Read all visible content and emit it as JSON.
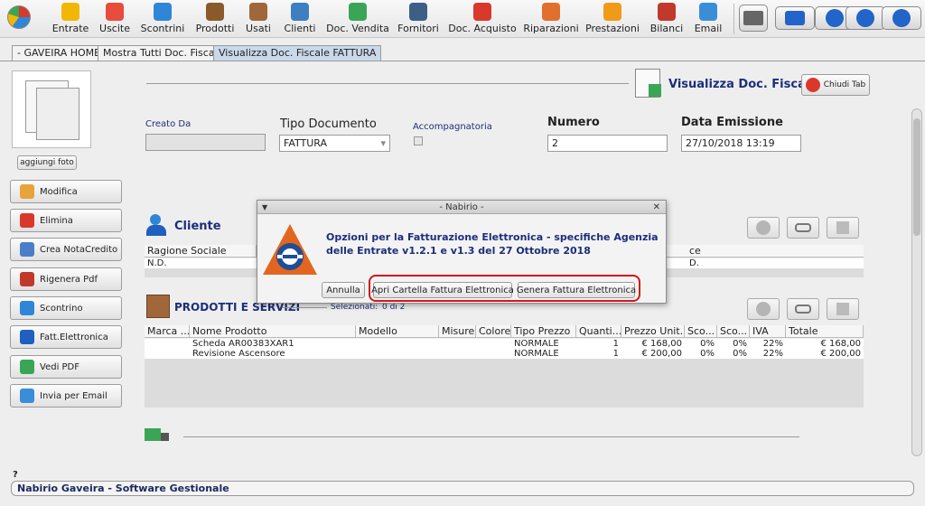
{
  "toolbar": {
    "items": [
      {
        "label": "Entrate",
        "color": "#f2b705"
      },
      {
        "label": "Uscite",
        "color": "#e74c3c"
      },
      {
        "label": "Scontrini",
        "color": "#2f86d6"
      },
      {
        "label": "Prodotti",
        "color": "#8b5a2b"
      },
      {
        "label": "Usati",
        "color": "#a0673a"
      },
      {
        "label": "Clienti",
        "color": "#3e7fc1"
      },
      {
        "label": "Doc. Vendita",
        "color": "#3aa655"
      },
      {
        "label": "Fornitori",
        "color": "#3c5f85"
      },
      {
        "label": "Doc. Acquisto",
        "color": "#d9392b"
      },
      {
        "label": "Riparazioni",
        "color": "#e0702c"
      },
      {
        "label": "Prestazioni",
        "color": "#f09a1a"
      },
      {
        "label": "Bilanci",
        "color": "#c0392b"
      },
      {
        "label": "Email",
        "color": "#3a8ed8"
      }
    ]
  },
  "tabs": [
    "- GAVEIRA HOME -",
    "Mostra Tutti Doc. Fiscale",
    "Visualizza Doc. Fiscale FATTURA"
  ],
  "left": {
    "add_photo": "aggiungi foto",
    "buttons": [
      {
        "label": "Modifica",
        "icon": "pencil-icon",
        "color": "#e8a33a"
      },
      {
        "label": "Elimina",
        "icon": "delete-icon",
        "color": "#d9392b"
      },
      {
        "label": "Crea NotaCredito",
        "icon": "note-icon",
        "color": "#4a7fc8"
      },
      {
        "label": "Rigenera Pdf",
        "icon": "pdf-icon",
        "color": "#c0392b"
      },
      {
        "label": "Scontrino",
        "icon": "receipt-icon",
        "color": "#2f86d6"
      },
      {
        "label": "Fatt.Elettronica",
        "icon": "einvoice-icon",
        "color": "#1f5fbf"
      },
      {
        "label": "Vedi PDF",
        "icon": "view-pdf-icon",
        "color": "#3aa655"
      },
      {
        "label": "Invia per Email",
        "icon": "email-icon",
        "color": "#3a8ed8"
      }
    ]
  },
  "header": {
    "title": "Visualizza Doc. Fiscale",
    "close_tab": "Chiudi Tab"
  },
  "form": {
    "created_by_label": "Creato Da",
    "created_by_value": "",
    "doc_type_label": "Tipo Documento",
    "doc_type_value": "FATTURA",
    "accompanying_label": "Accompagnatoria",
    "number_label": "Numero",
    "number_value": "2",
    "date_label": "Data Emissione",
    "date_value": "27/10/2018 13:19"
  },
  "client": {
    "section_title": "Cliente",
    "col1": "Ragione Sociale",
    "col2_partial": "ce",
    "row_value": "N.D.",
    "row_col2_partial": "D."
  },
  "products": {
    "section_title": "PRODOTTI E SERVIZI",
    "selected_label": "Selezionati:",
    "selected_value": "0 di 2",
    "columns": [
      "Marca ...",
      "Nome Prodotto",
      "Modello",
      "Misure",
      "Colore",
      "Tipo Prezzo",
      "Quanti...",
      "Prezzo Unit...",
      "Sco...",
      "Sco...",
      "IVA",
      "Totale"
    ],
    "rows": [
      {
        "name": "Scheda AR00383XAR1",
        "price_type": "NORMALE",
        "qty": "1",
        "unit_price": "€ 168,00",
        "disc1": "0%",
        "disc2": "0%",
        "vat": "22%",
        "total": "€ 168,00"
      },
      {
        "name": "Revisione Ascensore",
        "price_type": "NORMALE",
        "qty": "1",
        "unit_price": "€ 200,00",
        "disc1": "0%",
        "disc2": "0%",
        "vat": "22%",
        "total": "€ 200,00"
      }
    ]
  },
  "dialog": {
    "title": "- Nabirio -",
    "message": "Opzioni per la Fatturazione Elettronica - specifiche Agenzia delle Entrate v1.2.1 e v1.3 del 27 Ottobre 2018",
    "cancel": "Annulla",
    "open_folder": "Apri Cartella Fattura Elettronica",
    "generate": "Genera Fattura Elettronica",
    "highlight_color": "#d4161c"
  },
  "footer": {
    "question": "?",
    "text": "Nabirio Gaveira - Software Gestionale"
  }
}
